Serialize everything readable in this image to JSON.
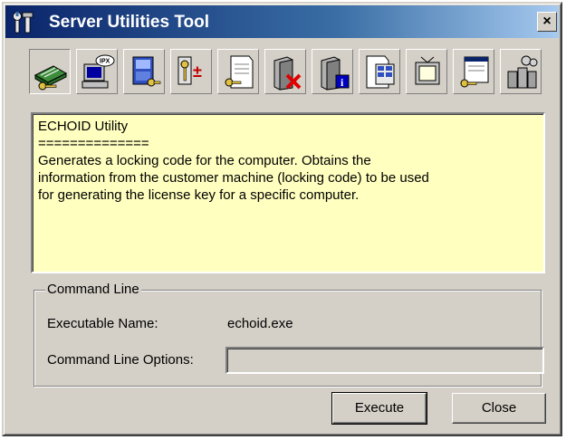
{
  "window": {
    "title": "Server Utilities Tool"
  },
  "toolbar": {
    "tools": [
      {
        "icon": "server-lock-icon"
      },
      {
        "icon": "ipx-computer-icon"
      },
      {
        "icon": "key-book-icon"
      },
      {
        "icon": "license-add-remove-icon"
      },
      {
        "icon": "document-key-icon"
      },
      {
        "icon": "server-delete-icon"
      },
      {
        "icon": "server-info-icon"
      },
      {
        "icon": "document-grid-icon"
      },
      {
        "icon": "monitor-icon"
      },
      {
        "icon": "window-key-icon"
      },
      {
        "icon": "gears-servers-icon"
      }
    ]
  },
  "description": {
    "title": "ECHOID Utility",
    "separator": "==============",
    "lines": [
      "Generates a locking code for the computer. Obtains the",
      "information from the customer machine (locking code) to be used",
      "for generating the license key for a specific computer."
    ]
  },
  "command_line": {
    "group_label": "Command Line",
    "exe_label": "Executable Name:",
    "exe_value": "echoid.exe",
    "options_label": "Command Line Options:",
    "options_value": ""
  },
  "buttons": {
    "execute": "Execute",
    "close": "Close",
    "title_close": "×"
  }
}
